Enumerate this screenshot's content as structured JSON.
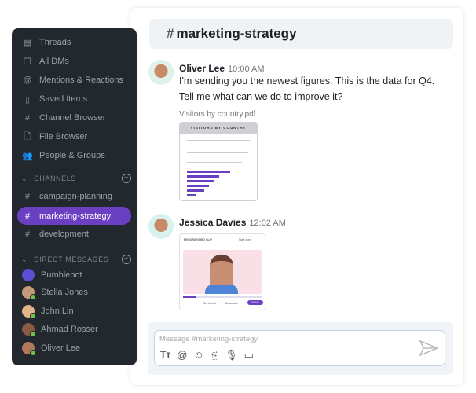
{
  "header": {
    "hash": "#",
    "channel": "marketing-strategy"
  },
  "sidebar": {
    "items": [
      {
        "label": "Threads",
        "icon": "threads-icon",
        "glyph": "▤"
      },
      {
        "label": "All DMs",
        "icon": "dms-icon",
        "glyph": "❐"
      },
      {
        "label": "Mentions & Reactions",
        "icon": "at-icon",
        "glyph": "@"
      },
      {
        "label": "Saved Items",
        "icon": "bookmark-icon",
        "glyph": "▯"
      },
      {
        "label": "Channel Browser",
        "icon": "channel-search-icon",
        "glyph": "#"
      },
      {
        "label": "File Browser",
        "icon": "file-search-icon",
        "glyph": "🗋"
      },
      {
        "label": "People & Groups",
        "icon": "people-icon",
        "glyph": "👥"
      }
    ],
    "channels_label": "CHANNELS",
    "channels": [
      "campaign-planning",
      "marketing-strategy",
      "development"
    ],
    "dm_label": "DIRECT MESSAGES",
    "dms": [
      "Pumblebot",
      "Stella Jones",
      "John Lin",
      "Ahmad Rosser",
      "Oliver Lee"
    ],
    "accent": "#6b3fc2"
  },
  "messages": [
    {
      "author": "Oliver Lee",
      "time": "10:00 AM",
      "line1": " I'm sending you the newest figures. This is the data for Q4.",
      "line2": "Tell me what can we do to improve it?",
      "attachment": "Visitors by country.pdf",
      "pdf_title": "VISITORS BY COUNTRY"
    },
    {
      "author": "Jessica Davies",
      "time": "12:02 AM",
      "video": {
        "title": "RECORD VIDEO CLIP",
        "start_over": "Start over",
        "set_thumb": "Set thumb",
        "download": "Download",
        "done": "DONE",
        "progress": 0.17
      }
    }
  ],
  "composer": {
    "placeholder": "Message #marketing-strategy"
  }
}
